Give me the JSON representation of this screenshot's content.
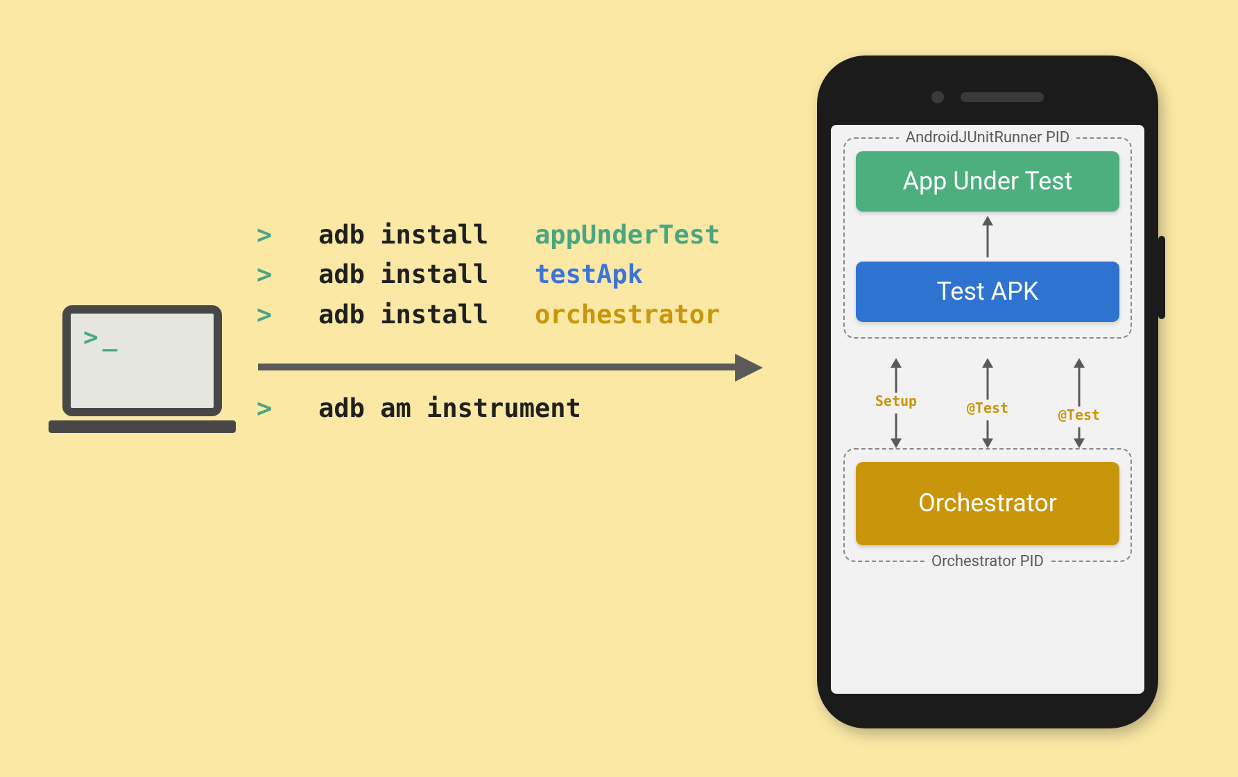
{
  "terminal": {
    "prompt": ">",
    "cmd_install": "adb install",
    "arg_app": "appUnderTest",
    "arg_testapk": "testApk",
    "arg_orch": "orchestrator",
    "cmd_instrument": "adb am instrument"
  },
  "laptop": {
    "prompt": ">_"
  },
  "phone": {
    "pid_runner": "AndroidJUnitRunner PID",
    "pid_orch": "Orchestrator PID",
    "box_app": "App Under Test",
    "box_test": "Test APK",
    "box_orch": "Orchestrator",
    "label_setup": "Setup",
    "label_test1": "@Test",
    "label_test2": "@Test"
  },
  "colors": {
    "bg": "#fae8a4",
    "green": "#4caf7d",
    "blue": "#2f73d1",
    "amber": "#c9960b",
    "grey": "#5a5a5a"
  }
}
